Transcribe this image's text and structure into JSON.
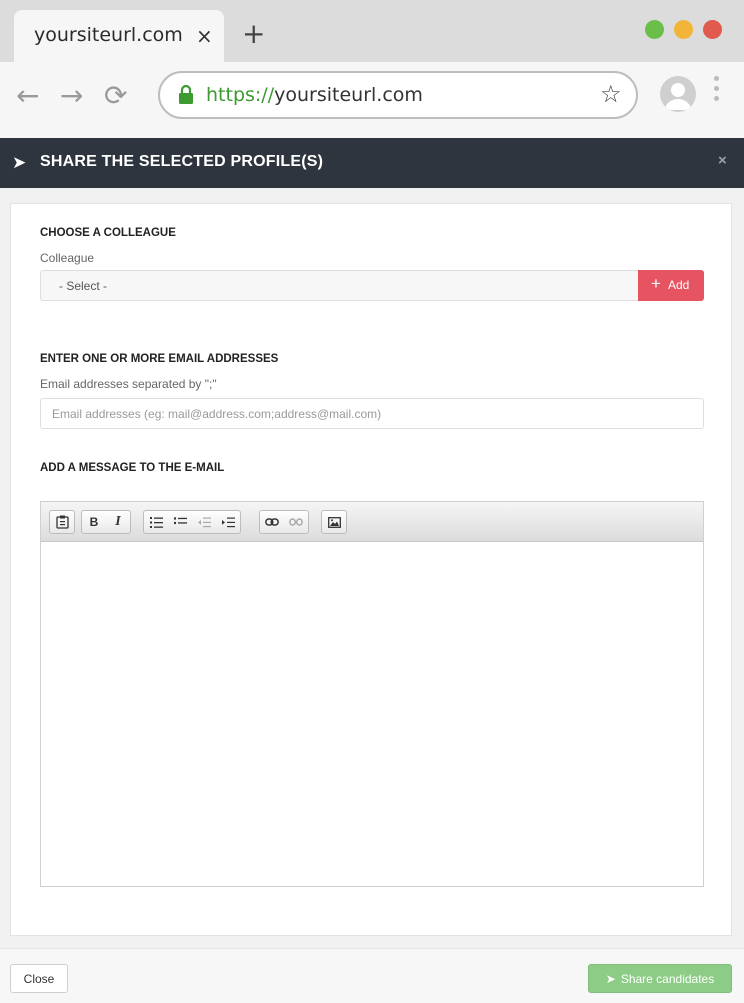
{
  "browser": {
    "tab_title": "yoursiteurl.com",
    "tab_close": "×",
    "new_tab": "+",
    "url_scheme": "https://",
    "url_host": "yoursiteurl.com",
    "traffic_lights": [
      "#6abf4b",
      "#f2b53a",
      "#e05a4e"
    ]
  },
  "modal": {
    "title": "SHARE THE SELECTED PROFILE(S)",
    "close": "×"
  },
  "colleague": {
    "section_title": "CHOOSE A COLLEAGUE",
    "label": "Colleague",
    "select_value": "- Select -",
    "add_label": "Add"
  },
  "email": {
    "section_title": "ENTER ONE OR MORE EMAIL ADDRESSES",
    "label": "Email addresses separated by \";\"",
    "placeholder": "Email addresses (eg: mail@address.com;address@mail.com)",
    "value": ""
  },
  "message": {
    "section_title": "ADD A MESSAGE TO THE E-MAIL",
    "toolbar_icons": [
      "paste-icon",
      "bold-icon",
      "italic-icon",
      "numbered-list-icon",
      "bulleted-list-icon",
      "outdent-icon",
      "indent-icon",
      "link-icon",
      "unlink-icon",
      "image-icon"
    ]
  },
  "footer": {
    "close_label": "Close",
    "share_label": "Share candidates"
  },
  "colors": {
    "header_bg": "#2e353e",
    "add_button": "#e65462",
    "share_button": "#8dcc86",
    "secure_url": "#3c9a31"
  }
}
